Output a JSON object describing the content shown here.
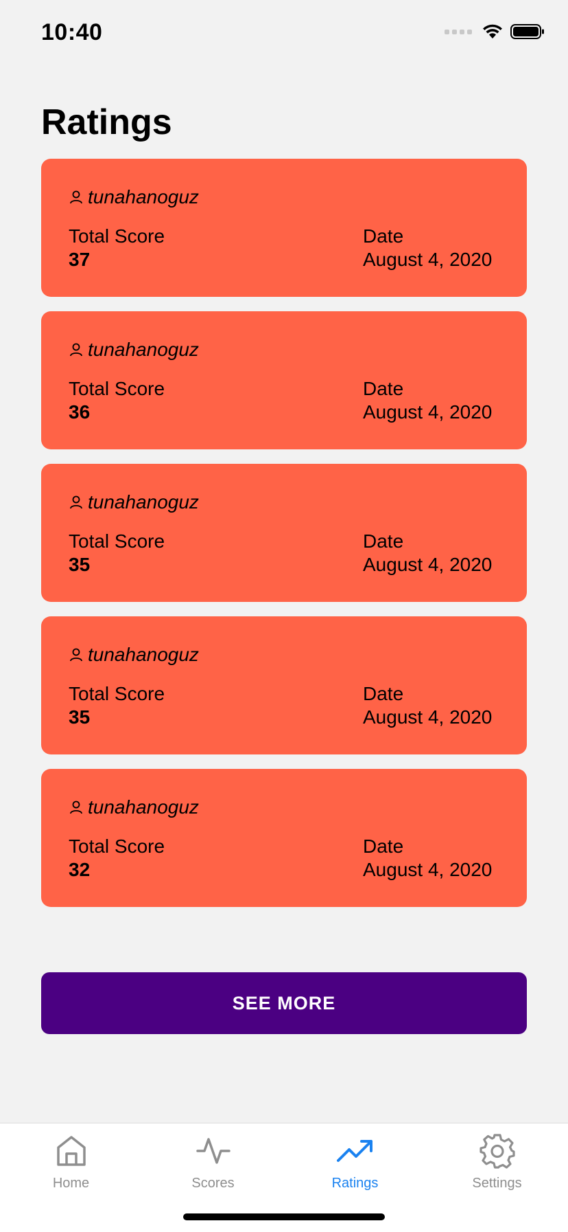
{
  "status_bar": {
    "time": "10:40"
  },
  "page": {
    "title": "Ratings"
  },
  "ratings": [
    {
      "username": "tunahanoguz",
      "score_label": "Total Score",
      "score": "37",
      "date_label": "Date",
      "date": "August 4, 2020"
    },
    {
      "username": "tunahanoguz",
      "score_label": "Total Score",
      "score": "36",
      "date_label": "Date",
      "date": "August 4, 2020"
    },
    {
      "username": "tunahanoguz",
      "score_label": "Total Score",
      "score": "35",
      "date_label": "Date",
      "date": "August 4, 2020"
    },
    {
      "username": "tunahanoguz",
      "score_label": "Total Score",
      "score": "35",
      "date_label": "Date",
      "date": "August 4, 2020"
    },
    {
      "username": "tunahanoguz",
      "score_label": "Total Score",
      "score": "32",
      "date_label": "Date",
      "date": "August 4, 2020"
    }
  ],
  "see_more": {
    "label": "SEE MORE"
  },
  "tab_bar": {
    "tabs": [
      {
        "label": "Home",
        "icon": "home-icon",
        "active": false
      },
      {
        "label": "Scores",
        "icon": "activity-icon",
        "active": false
      },
      {
        "label": "Ratings",
        "icon": "trending-up-icon",
        "active": true
      },
      {
        "label": "Settings",
        "icon": "gear-icon",
        "active": false
      }
    ]
  },
  "colors": {
    "background": "#f2f2f2",
    "card": "#ff6347",
    "button": "#4b0082",
    "tab_active": "#1a82f0",
    "tab_inactive": "#8e8e8e"
  }
}
